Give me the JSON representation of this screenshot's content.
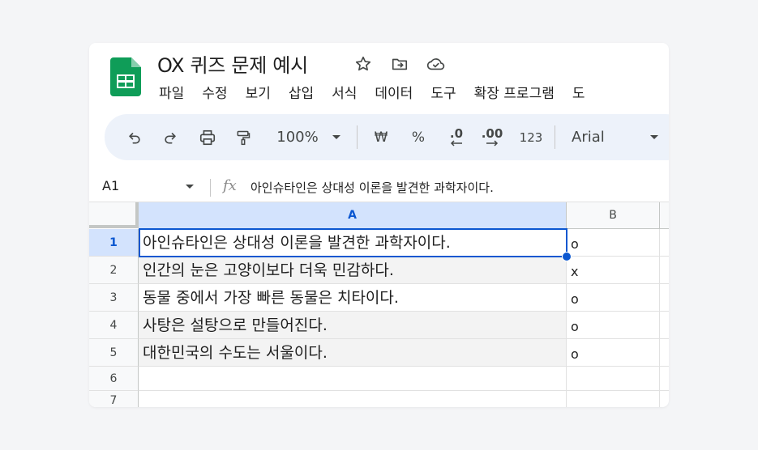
{
  "doc": {
    "title": "OX 퀴즈 문제 예시",
    "icons": [
      "star-icon",
      "move-to-folder-icon",
      "cloud-saved-icon"
    ]
  },
  "menu": [
    "파일",
    "수정",
    "보기",
    "삽입",
    "서식",
    "데이터",
    "도구",
    "확장 프로그램",
    "도"
  ],
  "toolbar": {
    "zoom": "100%",
    "currency": "₩",
    "percent": "%",
    "decrease_decimal": ".0",
    "increase_decimal": ".00",
    "number_format": "123",
    "font": "Arial"
  },
  "formula_bar": {
    "cell_ref": "A1",
    "fx": "fx",
    "content": "아인슈타인은 상대성 이론을 발견한 과학자이다."
  },
  "sheet": {
    "columns": [
      "A",
      "B"
    ],
    "rows": [
      {
        "num": "1",
        "a": "아인슈타인은 상대성 이론을 발견한 과학자이다.",
        "b": "o"
      },
      {
        "num": "2",
        "a": "인간의 눈은 고양이보다 더욱 민감하다.",
        "b": "x"
      },
      {
        "num": "3",
        "a": "동물 중에서 가장 빠른 동물은 치타이다.",
        "b": "o"
      },
      {
        "num": "4",
        "a": "사탕은 설탕으로 만들어진다.",
        "b": "o"
      },
      {
        "num": "5",
        "a": "대한민국의 수도는 서울이다.",
        "b": "o"
      },
      {
        "num": "6",
        "a": "",
        "b": ""
      },
      {
        "num": "7",
        "a": "",
        "b": ""
      }
    ],
    "selected_cell": "A1"
  },
  "colors": {
    "accent": "#0b57d0",
    "sheets_green": "#0f9d58",
    "toolbar_bg": "#edf2fa",
    "selected_header": "#d3e3fd"
  }
}
